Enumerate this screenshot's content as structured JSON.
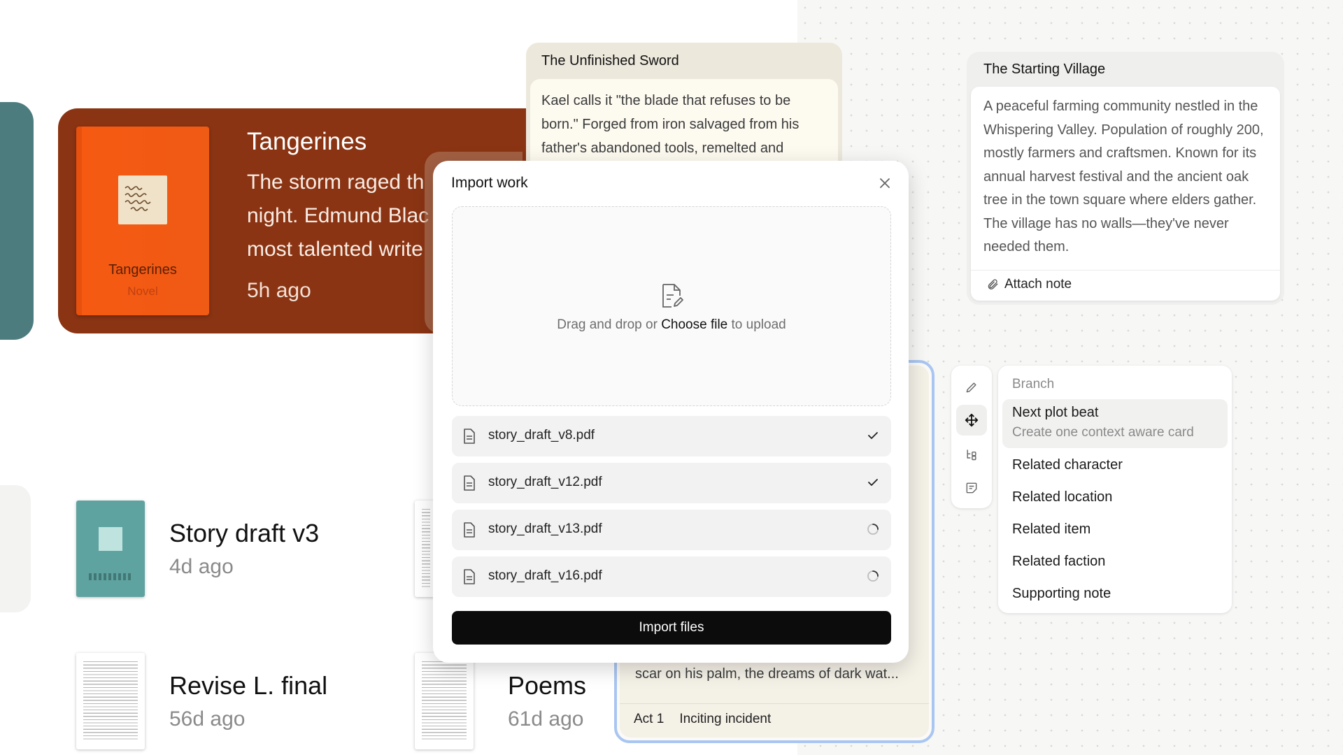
{
  "featured": {
    "title": "Tangerines",
    "excerpt_lines": [
      "The storm raged th",
      "night. Edmund Blac",
      "most talented write"
    ],
    "time": "5h ago",
    "cover_title": "Tangerines",
    "cover_subtitle": "Novel",
    "color": "#8a3413"
  },
  "documents": [
    {
      "name": "Story draft v3",
      "time": "4d ago"
    },
    {
      "name": "Revise L. final",
      "time": "56d ago"
    },
    {
      "name": "Poems",
      "time": "61d ago"
    }
  ],
  "cards": {
    "sword": {
      "title": "The Unfinished Sword",
      "body": "Kael calls it \"the blade that refuses to be born.\" Forged from iron salvaged from his father's abandoned tools, remelted and"
    },
    "village": {
      "title": "The Starting Village",
      "body": "A peaceful farming community nestled in the Whispering Valley. Population of roughly 200, mostly farmers and craftsmen. Known for its annual harvest festival and the ancient oak tree in the town square where elders gather. The village has no walls—they've never needed them.",
      "attach_label": "Attach note"
    },
    "selected": {
      "excerpt": "scar on his palm, the dreams of dark wat...",
      "act": "Act 1",
      "beat": "Inciting incident"
    }
  },
  "tools": [
    {
      "icon": "pencil-icon"
    },
    {
      "icon": "move-icon",
      "active": true
    },
    {
      "icon": "branch-icon"
    },
    {
      "icon": "note-icon"
    }
  ],
  "branch_menu": {
    "header": "Branch",
    "highlight": {
      "label": "Next plot beat",
      "sublabel": "Create one context aware card"
    },
    "items": [
      "Related character",
      "Related location",
      "Related item",
      "Related faction",
      "Supporting note"
    ]
  },
  "modal": {
    "title": "Import work",
    "dropzone": {
      "prefix": "Drag and drop or ",
      "link": "Choose file",
      "suffix": " to upload"
    },
    "files": [
      {
        "name": "story_draft_v8.pdf",
        "status": "done"
      },
      {
        "name": "story_draft_v12.pdf",
        "status": "done"
      },
      {
        "name": "story_draft_v13.pdf",
        "status": "loading"
      },
      {
        "name": "story_draft_v16.pdf",
        "status": "loading"
      }
    ],
    "import_label": "Import files"
  },
  "colors": {
    "accent_blue": "#a9c6f2",
    "button_dark": "#0c0c0c",
    "teal": "#4d7c7f",
    "orange": "#f65a12"
  }
}
